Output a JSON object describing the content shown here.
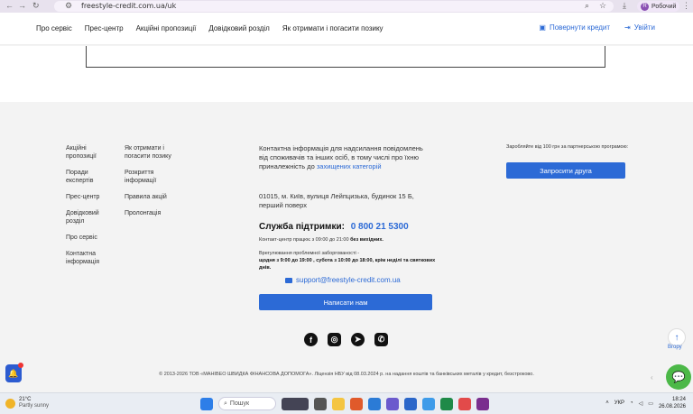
{
  "browser": {
    "url": "freestyle-credit.com.ua/uk",
    "profile_label": "Робочий",
    "profile_initial": "R"
  },
  "header": {
    "nav": [
      "Про сервіс",
      "Прес-центр",
      "Акційні пропозиції",
      "Довідковий розділ",
      "Як отримати і погасити позику"
    ],
    "return_credit": "Повернути кредит",
    "login": "Увійти"
  },
  "footer": {
    "col1": [
      "Акційні пропозиції",
      "Поради експертів",
      "Прес-центр",
      "Довідковий розділ",
      "Про сервіс",
      "Контактна інформація"
    ],
    "col2": [
      "Як отримати і погасити позику",
      "Розкриття інформації",
      "Правила акцій",
      "Пролонгація"
    ],
    "contact_text": "Контактна інформація для надсилання повідомлень від споживачів та інших осіб, в тому числі про їхню приналежність до",
    "contact_link": "захищених категорій",
    "address": "01015, м. Київ, вулиця Лейпцизька, будинок 15 Б, перший поверх",
    "support_label": "Служба підтримки:",
    "support_phone": "0 800 21 5300",
    "hours_text": "Контакт-центр працює з 09:00 до 21:00",
    "hours_bold": "без вихідних.",
    "complaints_text": "Врегулювання проблемної заборгованості -",
    "complaints_bold": "щодня з 9:00 до 19:00 , субота з 10:00 до 18:00, крім неділі та святкових днів.",
    "email": "support@freestyle-credit.com.ua",
    "write_button": "Написати нам",
    "partner_text": "Заробляйте від 100 грн за партнерською програмою:",
    "invite_button": "Запросити друга",
    "social_icons": [
      "facebook-icon",
      "instagram-icon",
      "telegram-icon",
      "viber-icon"
    ],
    "copyright": "© 2013-2026 ТОВ «МАНІВЕО ШВИДКА ФІНАНСОВА ДОПОМОГА». Ліцензія НБУ від 08.03.2024 р. на надання коштів та банківських металів у кредит, безстроково.",
    "to_top_label": "Вгору"
  },
  "taskbar": {
    "temperature": "21°C",
    "weather": "Partly sunny",
    "search_placeholder": "Пошук",
    "lang": "УКР",
    "time": "18:24",
    "date": "26.08.2026"
  },
  "colors": {
    "accent": "#2c6ad6",
    "chat": "#4cb848",
    "footer_bg": "#f3f3f3"
  }
}
